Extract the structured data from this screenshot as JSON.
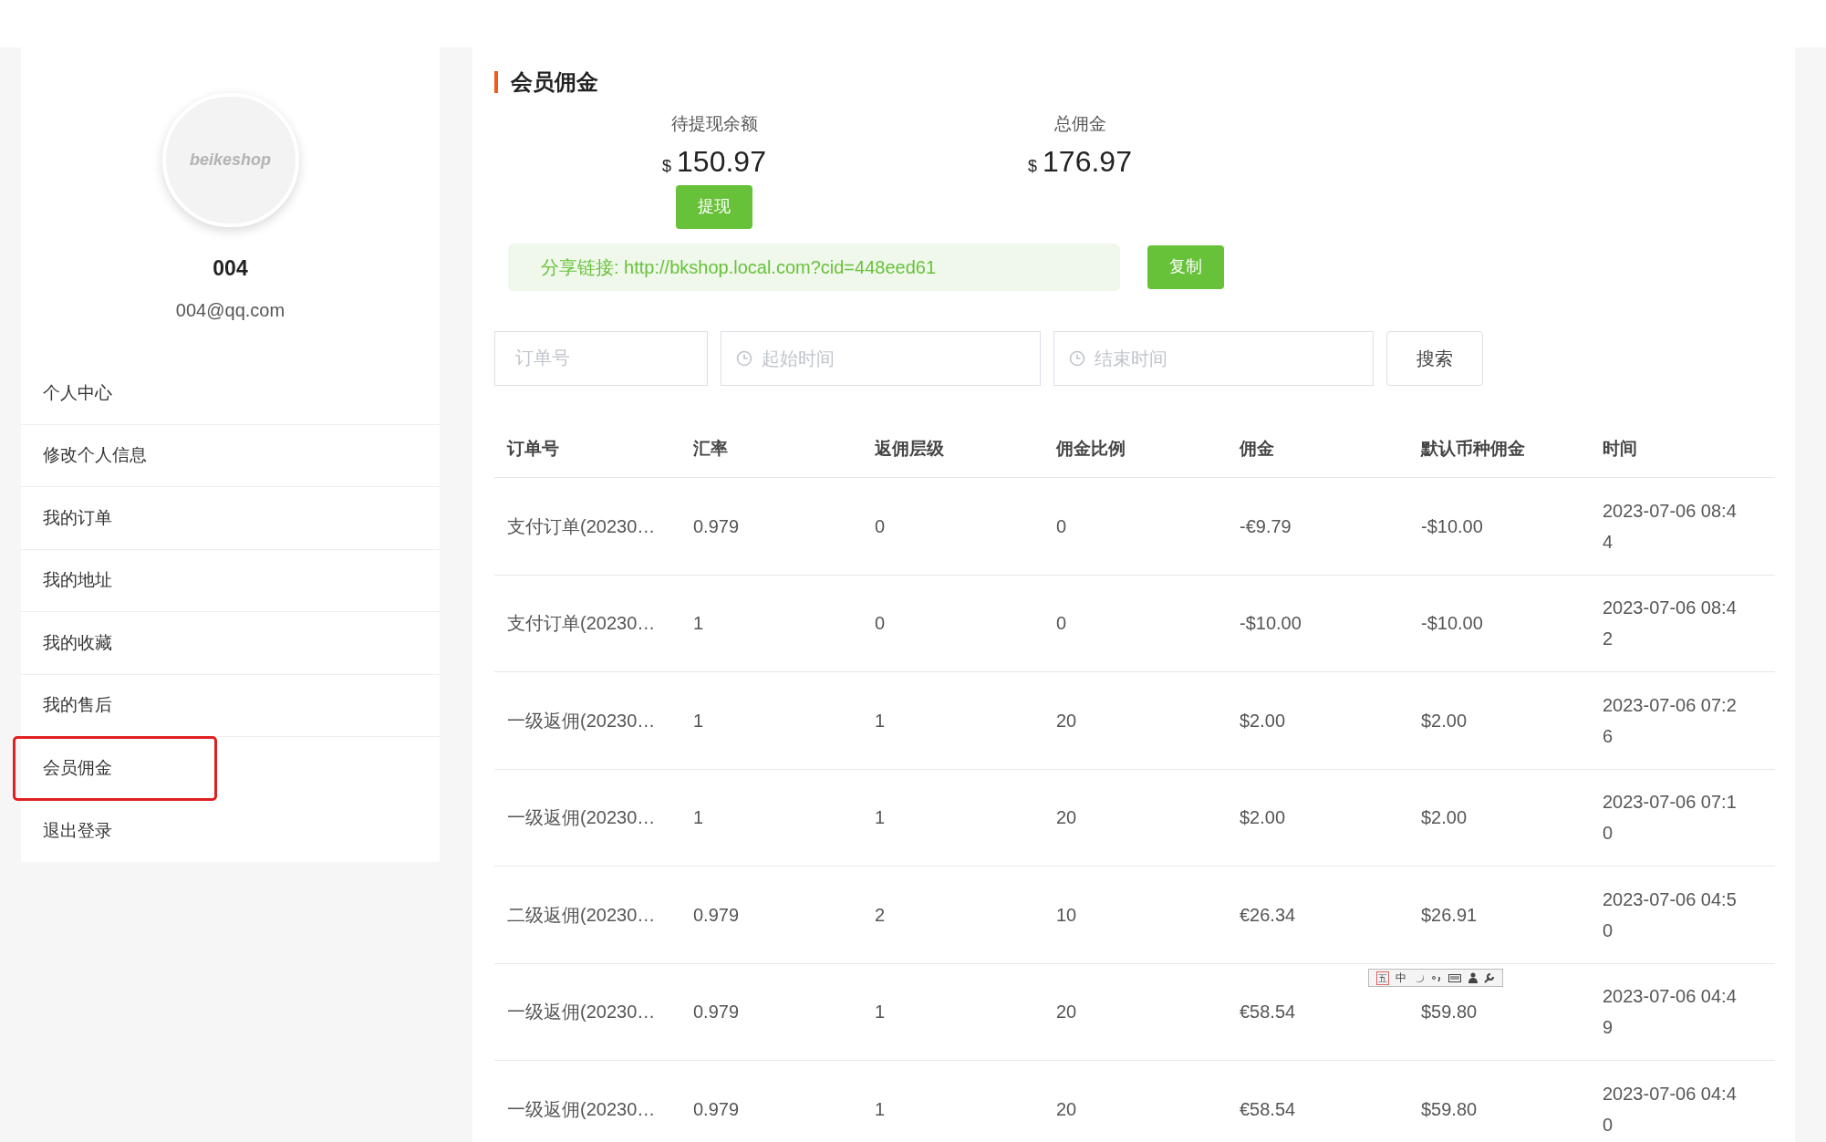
{
  "sidebar": {
    "avatar_text": "beikeshop",
    "name": "004",
    "email": "004@qq.com",
    "items": [
      {
        "label": "个人中心",
        "selected": false
      },
      {
        "label": "修改个人信息",
        "selected": false
      },
      {
        "label": "我的订单",
        "selected": false
      },
      {
        "label": "我的地址",
        "selected": false
      },
      {
        "label": "我的收藏",
        "selected": false
      },
      {
        "label": "我的售后",
        "selected": false
      },
      {
        "label": "会员佣金",
        "selected": true
      },
      {
        "label": "退出登录",
        "selected": false
      }
    ]
  },
  "main": {
    "title": "会员佣金",
    "summary": [
      {
        "label": "待提现余额",
        "currency": "$",
        "amount": "150.97",
        "button": "提现"
      },
      {
        "label": "总佣金",
        "currency": "$",
        "amount": "176.97"
      }
    ],
    "share": {
      "label": "分享链接: http://bkshop.local.com?cid=448eed61",
      "button": "复制"
    },
    "filters": {
      "order_placeholder": "订单号",
      "start_placeholder": "起始时间",
      "end_placeholder": "结束时间",
      "search_button": "搜索"
    },
    "table": {
      "columns": [
        "订单号",
        "汇率",
        "返佣层级",
        "佣金比例",
        "佣金",
        "默认币种佣金",
        "时间"
      ],
      "rows": [
        [
          "支付订单(20230…",
          "0.979",
          "0",
          "0",
          "-€9.79",
          "-$10.00",
          "2023-07-06 08:44"
        ],
        [
          "支付订单(20230…",
          "1",
          "0",
          "0",
          "-$10.00",
          "-$10.00",
          "2023-07-06 08:42"
        ],
        [
          "一级返佣(20230…",
          "1",
          "1",
          "20",
          "$2.00",
          "$2.00",
          "2023-07-06 07:26"
        ],
        [
          "一级返佣(20230…",
          "1",
          "1",
          "20",
          "$2.00",
          "$2.00",
          "2023-07-06 07:10"
        ],
        [
          "二级返佣(20230…",
          "0.979",
          "2",
          "10",
          "€26.34",
          "$26.91",
          "2023-07-06 04:50"
        ],
        [
          "一级返佣(20230…",
          "0.979",
          "1",
          "20",
          "€58.54",
          "$59.80",
          "2023-07-06 04:49"
        ],
        [
          "一级返佣(20230…",
          "0.979",
          "1",
          "20",
          "€58.54",
          "$59.80",
          "2023-07-06 04:40"
        ]
      ]
    }
  },
  "ime_toolbar": {
    "items": [
      "五",
      "中"
    ]
  }
}
